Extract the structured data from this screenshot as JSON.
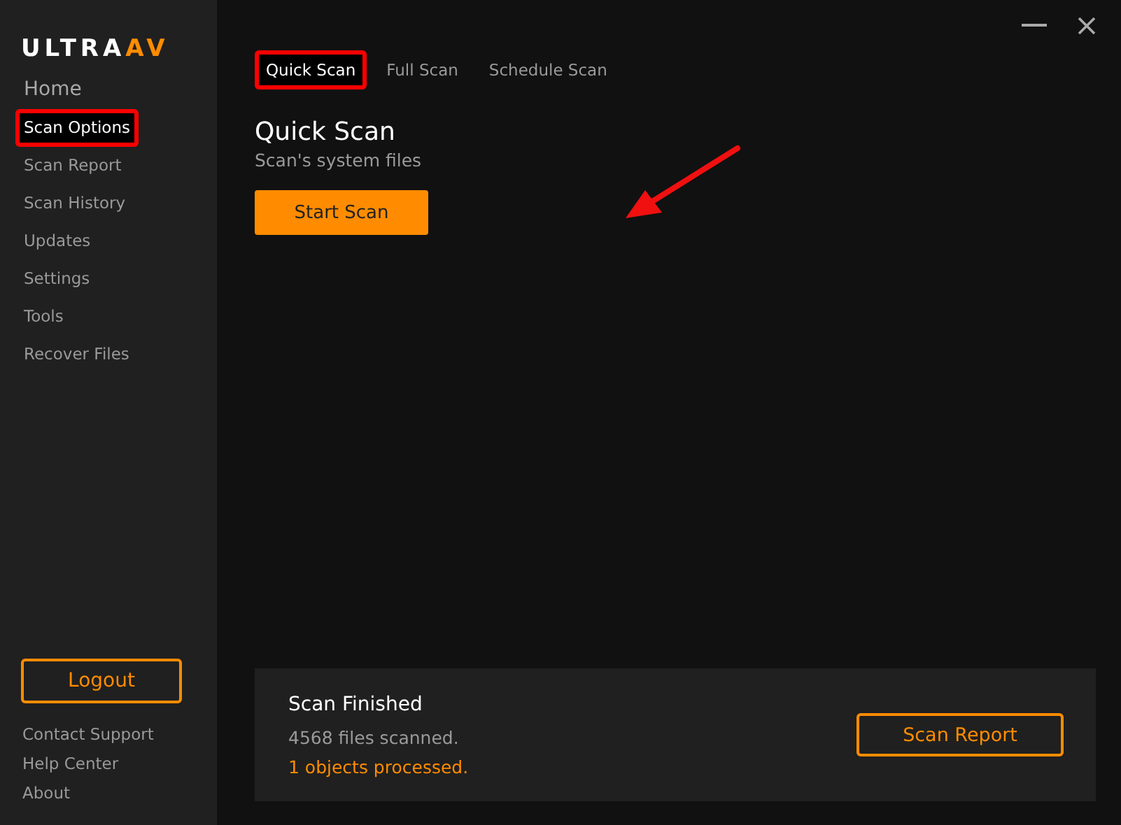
{
  "logo": {
    "main": "ULTRA",
    "accent": "AV"
  },
  "sidebar": {
    "items": [
      {
        "label": "Home",
        "kind": "heading",
        "selected": false,
        "highlighted": false
      },
      {
        "label": "Scan Options",
        "kind": "link",
        "selected": true,
        "highlighted": true
      },
      {
        "label": "Scan Report",
        "kind": "link",
        "selected": false,
        "highlighted": false
      },
      {
        "label": "Scan History",
        "kind": "link",
        "selected": false,
        "highlighted": false
      },
      {
        "label": "Updates",
        "kind": "link",
        "selected": false,
        "highlighted": false
      },
      {
        "label": "Settings",
        "kind": "link",
        "selected": false,
        "highlighted": false
      },
      {
        "label": "Tools",
        "kind": "link",
        "selected": false,
        "highlighted": false
      },
      {
        "label": "Recover Files",
        "kind": "link",
        "selected": false,
        "highlighted": false
      }
    ],
    "logout_button": "Logout",
    "footer_links": [
      "Contact Support",
      "Help Center",
      "About"
    ]
  },
  "tabs": [
    {
      "label": "Quick Scan",
      "selected": true,
      "highlighted": true
    },
    {
      "label": "Full Scan",
      "selected": false,
      "highlighted": false
    },
    {
      "label": "Schedule Scan",
      "selected": false,
      "highlighted": false
    }
  ],
  "content": {
    "title": "Quick Scan",
    "subtitle": "Scan's system files",
    "start_button": "Start Scan"
  },
  "status_panel": {
    "title": "Scan Finished",
    "files_scanned": "4568 files scanned.",
    "objects_processed": "1 objects processed.",
    "report_button": "Scan Report"
  }
}
